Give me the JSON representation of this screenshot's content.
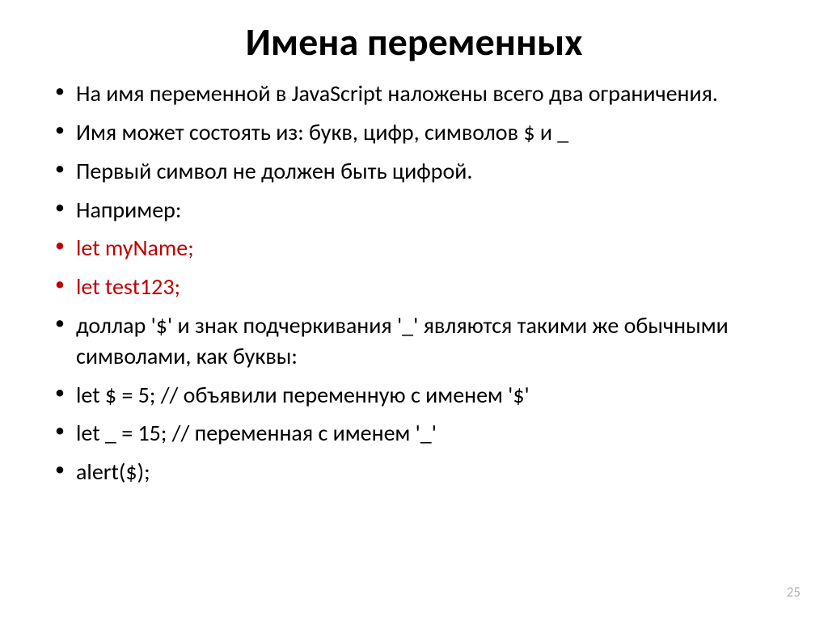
{
  "title": "Имена переменных",
  "bullets": [
    {
      "text": "На имя переменной в JavaScript наложены всего два ограничения.",
      "red": false
    },
    {
      "text": "Имя может состоять из: букв, цифр, символов $ и _",
      "red": false
    },
    {
      "text": "Первый символ не должен быть цифрой.",
      "red": false
    },
    {
      "text": "Например:",
      "red": false
    },
    {
      "text": "let myName;",
      "red": true
    },
    {
      "text": "let  test123;",
      "red": true
    },
    {
      "text": "доллар '$' и знак подчеркивания '_' являются такими же обычными символами, как буквы:",
      "red": false
    },
    {
      "text": "let $ = 5;  // объявили переменную с именем '$'",
      "red": false
    },
    {
      "text": "let  _ = 15; // переменная с именем '_'",
      "red": false
    },
    {
      "text": "alert($);",
      "red": false
    }
  ],
  "page_number": "25"
}
